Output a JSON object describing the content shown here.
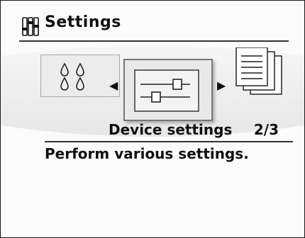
{
  "header": {
    "title": "Settings",
    "icon": "settings-icon"
  },
  "carousel": {
    "items": [
      {
        "name": "ink-icon"
      },
      {
        "name": "device-settings-icon",
        "selected": true
      },
      {
        "name": "documents-icon"
      }
    ]
  },
  "selection": {
    "label": "Device settings",
    "page": "2/3",
    "description": "Perform various settings."
  }
}
